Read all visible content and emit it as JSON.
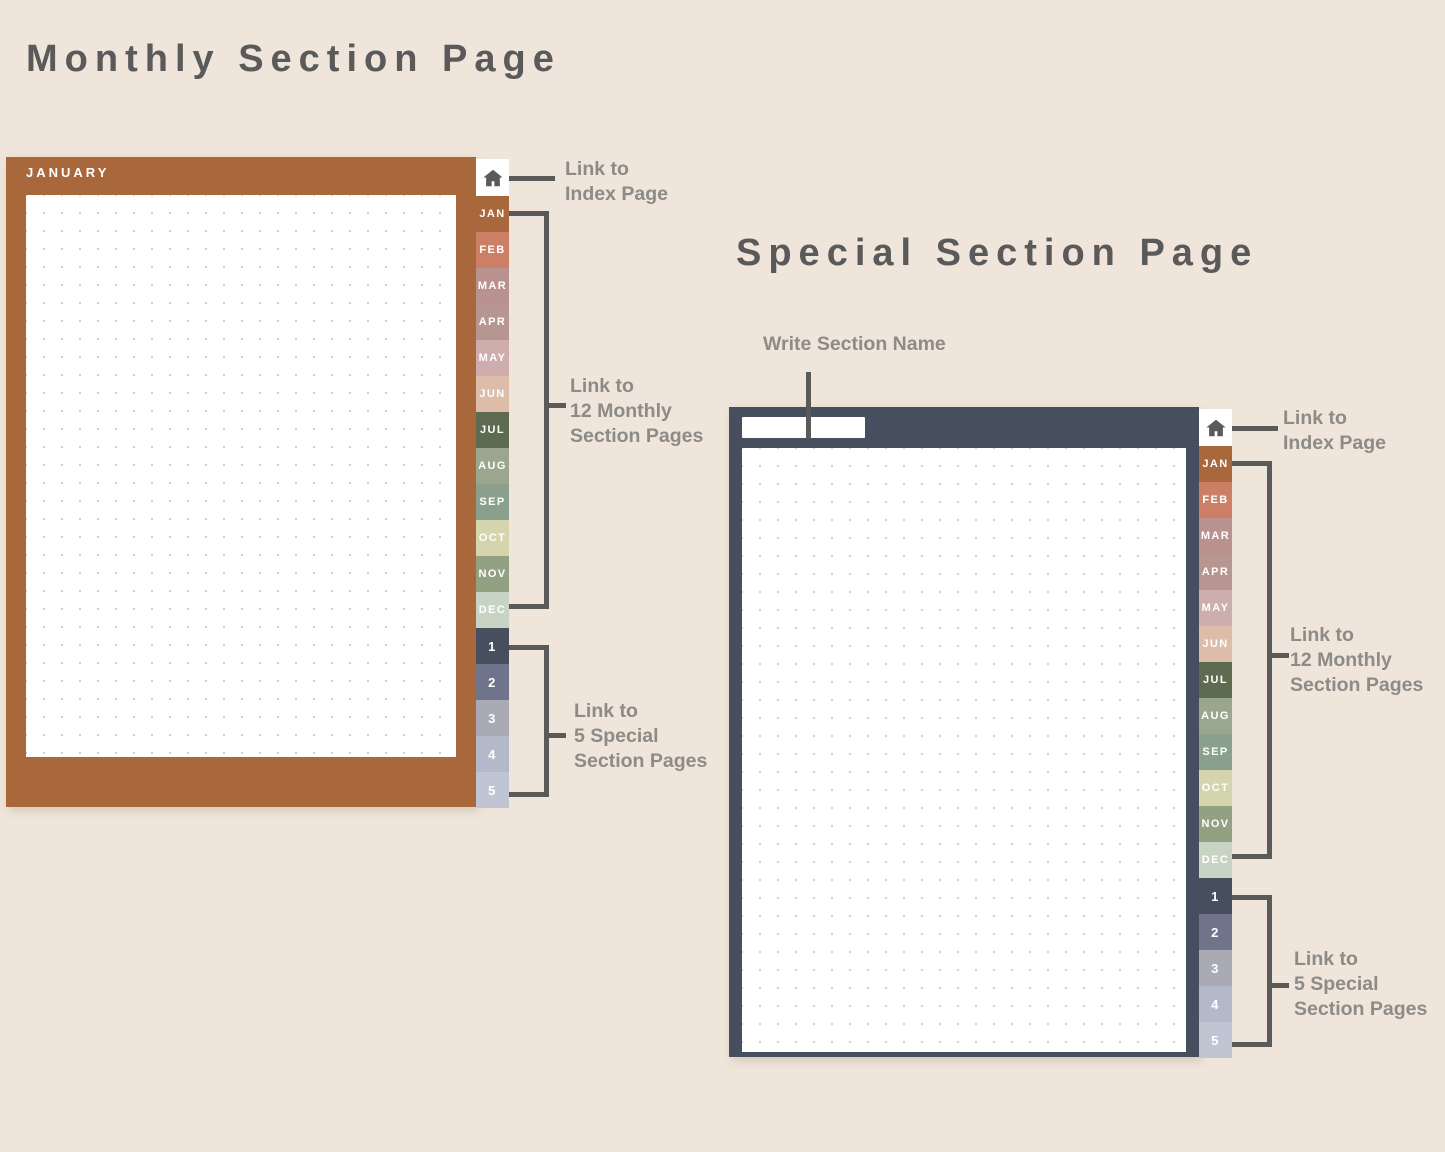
{
  "background_color": "#efe5da",
  "headings": {
    "monthly": "Monthly Section Page",
    "special": "Special Section Page"
  },
  "annotations": {
    "monthly_index": "Link to\nIndex Page",
    "monthly_months": "Link to\n12 Monthly\nSection Pages",
    "monthly_special": "Link to\n5 Special\nSection Pages",
    "special_write_name": "Write Section Name",
    "special_index": "Link to\nIndex Page",
    "special_months": "Link to\n12 Monthly\nSection Pages",
    "special_special": "Link to\n5 Special\nSection Pages"
  },
  "monthly_planner": {
    "frame_color": "#a9673c",
    "month_title": "JANUARY",
    "home_icon": "home-icon"
  },
  "special_planner": {
    "frame_color": "#474f5e",
    "name_field_value": "",
    "name_field_placeholder": "",
    "home_icon": "home-icon"
  },
  "tabs": {
    "month_tabs": [
      {
        "label": "JAN",
        "color": "#a9673c"
      },
      {
        "label": "FEB",
        "color": "#cc7f64"
      },
      {
        "label": "MAR",
        "color": "#b99290"
      },
      {
        "label": "APR",
        "color": "#b79691"
      },
      {
        "label": "MAY",
        "color": "#cdaeac"
      },
      {
        "label": "JUN",
        "color": "#ddbcaa"
      },
      {
        "label": "JUL",
        "color": "#5d6b50"
      },
      {
        "label": "AUG",
        "color": "#9aa68d"
      },
      {
        "label": "SEP",
        "color": "#8aa08d"
      },
      {
        "label": "OCT",
        "color": "#d4d4ad"
      },
      {
        "label": "NOV",
        "color": "#93a183"
      },
      {
        "label": "DEC",
        "color": "#c7d4c4"
      }
    ],
    "number_tabs": [
      {
        "label": "1",
        "color": "#474f5e"
      },
      {
        "label": "2",
        "color": "#6f748a"
      },
      {
        "label": "3",
        "color": "#a9aab3"
      },
      {
        "label": "4",
        "color": "#b3b9c8"
      },
      {
        "label": "5",
        "color": "#bfc5d2"
      }
    ]
  }
}
